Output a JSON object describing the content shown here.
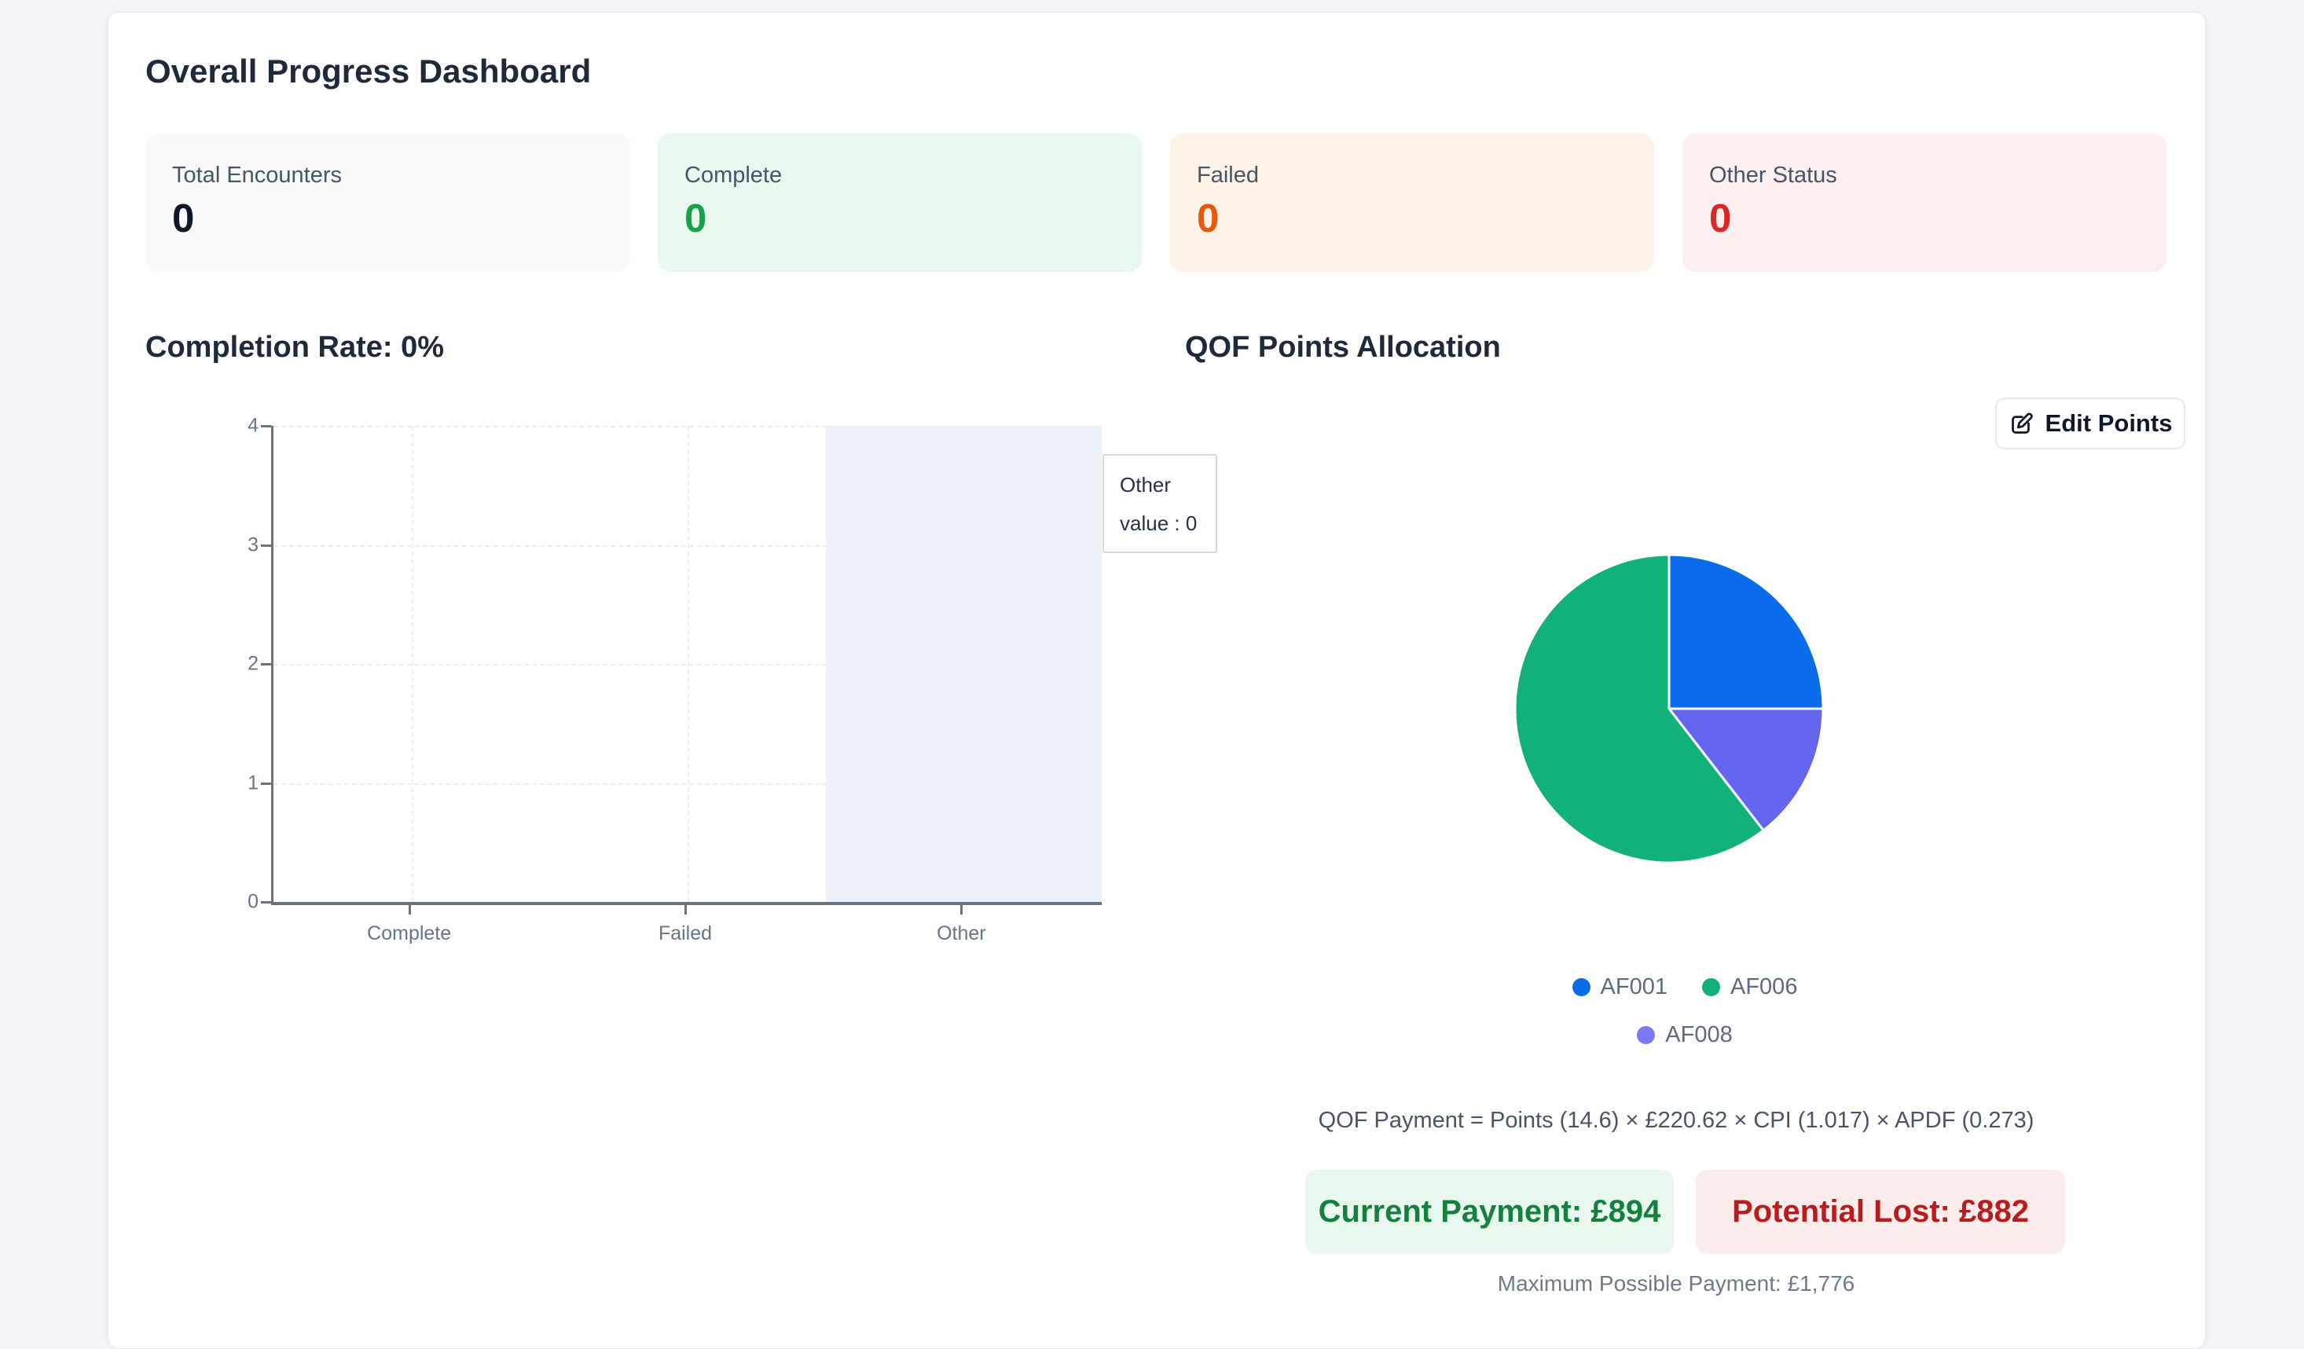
{
  "page": {
    "background": "#f3f5f9"
  },
  "dashboard": {
    "title": "Overall Progress Dashboard",
    "stats": [
      {
        "label": "Total Encounters",
        "value": "0",
        "bg": "#f7f9fb",
        "value_color": "#0f172a"
      },
      {
        "label": "Complete",
        "value": "0",
        "bg": "#e9f8ef",
        "value_color": "#17a34a"
      },
      {
        "label": "Failed",
        "value": "0",
        "bg": "#fdf3e8",
        "value_color": "#ea580c"
      },
      {
        "label": "Other Status",
        "value": "0",
        "bg": "#fbeff0",
        "value_color": "#dc2626"
      }
    ],
    "completion": {
      "heading": "Completion Rate: 0%",
      "tooltip": {
        "title": "Other",
        "line": "value : 0"
      }
    },
    "qof": {
      "heading": "QOF Points Allocation",
      "edit_button_label": "Edit Points",
      "edit_button_icon": "pencil-square-icon",
      "legend": [
        {
          "label": "AF001",
          "color": "#0b6ceb"
        },
        {
          "label": "AF006",
          "color": "#12b17a"
        },
        {
          "label": "AF008",
          "color": "#7b79f3"
        }
      ],
      "formula": "QOF Payment = Points (14.6) × £220.62 × CPI (1.017) × APDF (0.273)",
      "current_payment": "Current Payment: £894",
      "potential_lost": "Potential Lost: £882",
      "max_payment": "Maximum Possible Payment: £1,776",
      "current_color": "#15803d",
      "lost_color": "#b91c1c"
    }
  },
  "chart_data": [
    {
      "type": "bar",
      "title": "Completion Rate: 0%",
      "categories": [
        "Complete",
        "Failed",
        "Other"
      ],
      "values": [
        0,
        0,
        0
      ],
      "xlabel": "",
      "ylabel": "",
      "ylim": [
        0,
        4
      ],
      "yticks": [
        0,
        1,
        2,
        3,
        4
      ],
      "grid": true,
      "grid_style": "dashed",
      "highlighted_category": "Other",
      "highlight_band_color": "#edf1f8",
      "tooltip": {
        "category": "Other",
        "text": "value : 0",
        "value": 0
      },
      "axis_color": "#6b7280",
      "tick_label_color": "#64748b"
    },
    {
      "type": "pie",
      "title": "QOF Points Allocation",
      "labels": [
        "AF001",
        "AF006",
        "AF008"
      ],
      "values_pct": [
        25.0,
        60.5,
        14.5
      ],
      "colors": [
        "#0b6ceb",
        "#12b17a",
        "#6366ec"
      ],
      "slices_clockwise_from_top": [
        {
          "label": "AF001",
          "pct": 25.0,
          "color": "#0b6ceb"
        },
        {
          "label": "AF008",
          "pct": 14.5,
          "color": "#6366ec"
        },
        {
          "label": "AF006",
          "pct": 60.5,
          "color": "#12b17a"
        }
      ],
      "legend_position": "bottom",
      "slice_border_color": "#ffffff"
    }
  ]
}
